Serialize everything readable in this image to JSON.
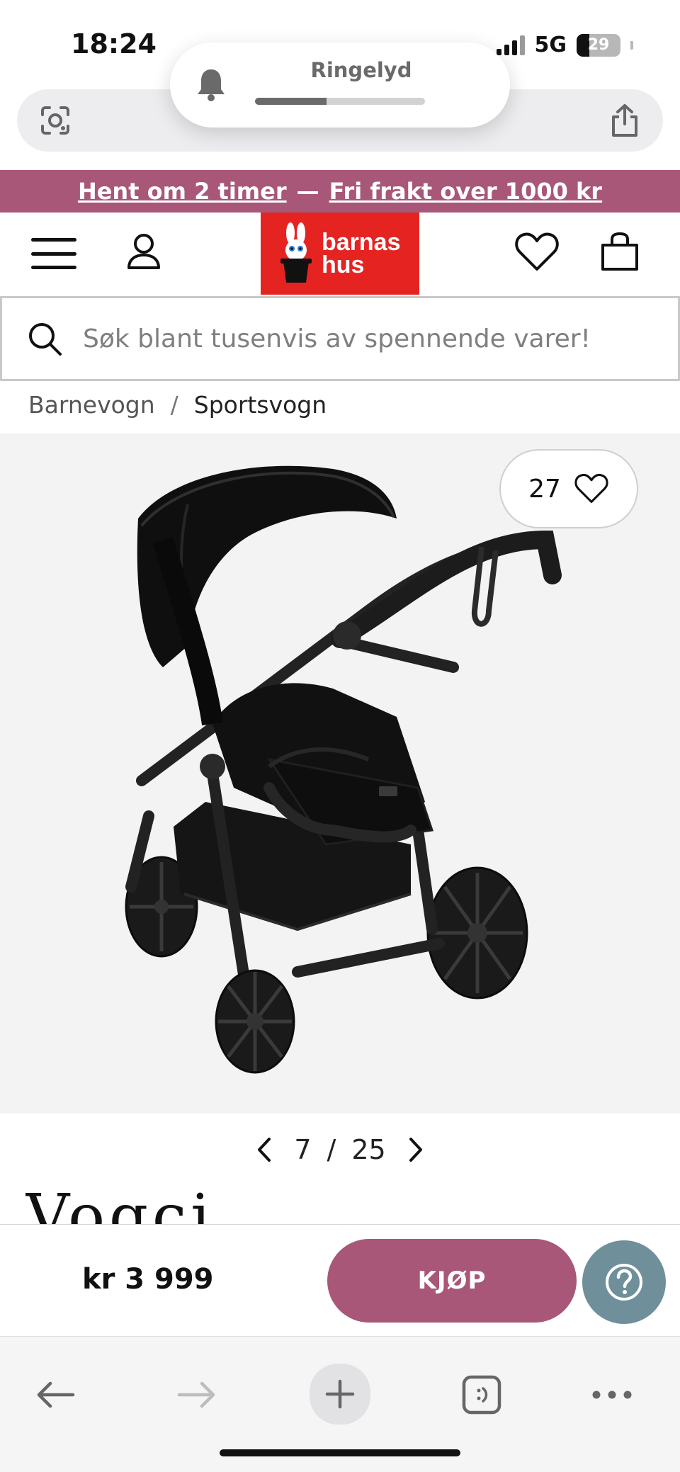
{
  "status_bar": {
    "time": "18:24",
    "network": "5G",
    "battery": "29",
    "battery_level": 0.29
  },
  "ringer_overlay": {
    "label": "Ringelyd",
    "level": 0.42
  },
  "promo": {
    "pickup": "Hent om 2 timer",
    "separator": "—",
    "shipping": "Fri frakt over 1000 kr"
  },
  "header": {
    "logo_line1": "barnas",
    "logo_line2": "hus",
    "icons": [
      "menu-icon",
      "account-icon",
      "heart-icon",
      "bag-icon"
    ]
  },
  "search": {
    "placeholder": "Søk blant tusenvis av spennende varer!",
    "value": ""
  },
  "breadcrumb": {
    "items": [
      {
        "label": "Barnevogn"
      },
      {
        "label": "Sportsvogn"
      }
    ],
    "separator": "/"
  },
  "gallery": {
    "favorites_count": "27",
    "current": "7",
    "separator": "/",
    "total": "25"
  },
  "brand": {
    "name": "Vogci"
  },
  "buy_bar": {
    "price": "kr 3 999",
    "buy_label": "KJØP"
  },
  "colors": {
    "brand_pink": "#a85778",
    "logo_red": "#e52422",
    "help_blue": "#6f8f9a"
  }
}
